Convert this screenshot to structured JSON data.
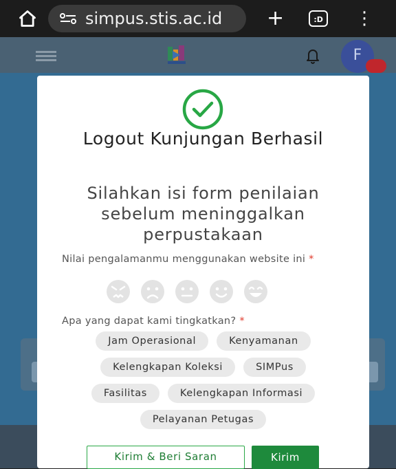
{
  "browser": {
    "url": "simpus.stis.ac.id",
    "tab_switcher_label": ":D"
  },
  "app": {
    "avatar_initial": "F"
  },
  "modal": {
    "title": "Logout Kunjungan Berhasil",
    "subtitle": "Silahkan isi form penilaian sebelum meninggalkan perpustakaan",
    "rating_question": "Nilai pengalamanmu menggunakan website ini",
    "rating_required_mark": "*",
    "rating_options": [
      "very-angry-face-icon",
      "sad-face-icon",
      "neutral-face-icon",
      "smiling-face-icon",
      "grinning-face-icon"
    ],
    "improve_question": "Apa yang dapat kami tingkatkan?",
    "improve_required_mark": "*",
    "improve_options": {
      "row1": [
        "Jam Operasional",
        "Kenyamanan"
      ],
      "row2": [
        "Kelengkapan Koleksi",
        "SIMPus"
      ],
      "row3": [
        "Fasilitas",
        "Kelengkapan Informasi"
      ],
      "row4": [
        "Pelayanan Petugas"
      ]
    },
    "secondary_button": "Kirim & Beri Saran",
    "primary_button": "Kirim"
  },
  "colors": {
    "success_green": "#28a745",
    "overlay_page": "#336b92",
    "appbar": "#4a6173"
  }
}
